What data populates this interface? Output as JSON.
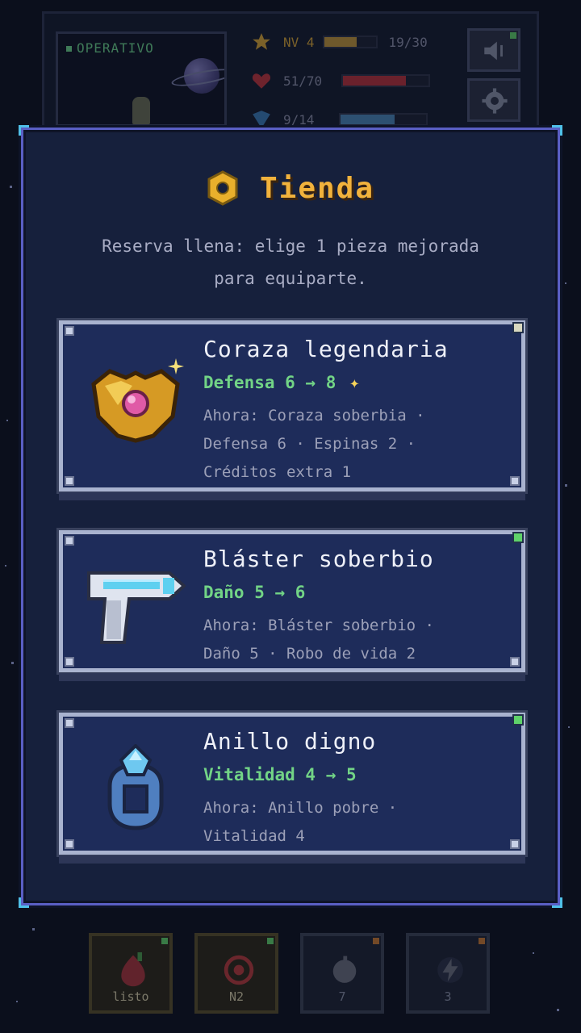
{
  "hud": {
    "status": "OPERATIVO",
    "level_label": "NV 4",
    "xp_text": "19/30",
    "xp_fraction": 0.63,
    "hp_text": "51/70",
    "hp_fraction": 0.73,
    "shield_text": "9/14",
    "shield_fraction": 0.64
  },
  "modal": {
    "title": "Tienda",
    "subtitle_line1": "Reserva llena: elige 1 pieza mejorada",
    "subtitle_line2": "para equiparte."
  },
  "items": [
    {
      "name": "Coraza legendaria",
      "change": "Defensa 6 → 8",
      "now_line1": "Ahora: Coraza soberbia ·",
      "now_line2": "Defensa 6 · Espinas 2 ·",
      "now_line3": "Créditos extra 1",
      "icon": "armor-icon",
      "led_color": "#c8c8b0"
    },
    {
      "name": "Bláster soberbio",
      "change": "Daño 5 → 6",
      "now_line1": "Ahora: Bláster soberbio ·",
      "now_line2": "Daño 5 · Robo de vida 2",
      "icon": "blaster-icon",
      "led_color": "#5fd26a"
    },
    {
      "name": "Anillo digno",
      "change": "Vitalidad 4 → 5",
      "now_line1": "Ahora: Anillo pobre ·",
      "now_line2": "Vitalidad 4",
      "icon": "ring-icon",
      "led_color": "#5fd26a"
    }
  ],
  "slots": [
    {
      "label": "listo",
      "icon": "potion-icon"
    },
    {
      "label": "N2",
      "icon": "target-icon"
    },
    {
      "label": "7",
      "icon": "bomb-icon"
    },
    {
      "label": "3",
      "icon": "lightning-icon"
    }
  ],
  "colors": {
    "accent_gold": "#f1b23c",
    "upgrade_green": "#72d486",
    "frame_purple": "#5a5fc4",
    "corner_cyan": "#4fc0e8"
  }
}
